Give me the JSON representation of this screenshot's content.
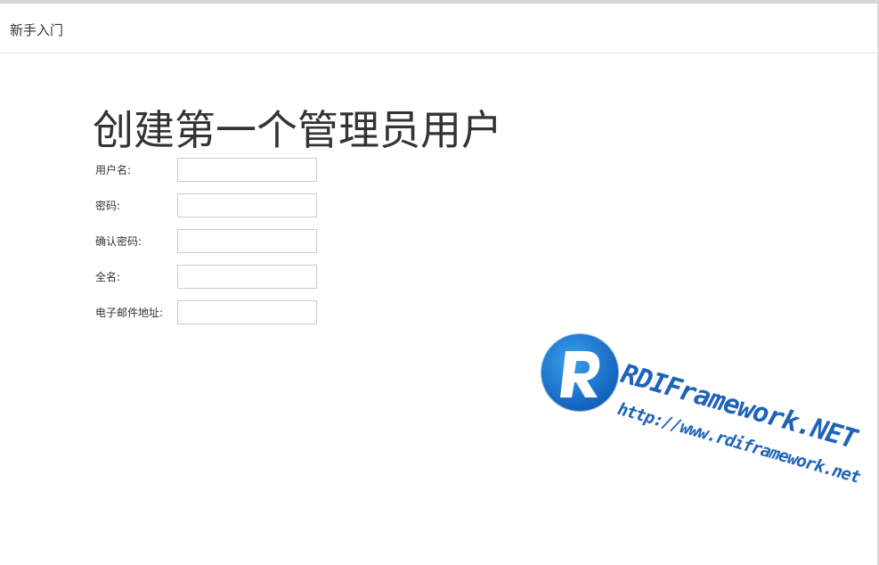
{
  "header": {
    "title": "新手入门"
  },
  "page": {
    "title": "创建第一个管理员用户"
  },
  "form": {
    "fields": [
      {
        "label": "用户名:",
        "value": ""
      },
      {
        "label": "密码:",
        "value": ""
      },
      {
        "label": "确认密码:",
        "value": ""
      },
      {
        "label": "全名:",
        "value": ""
      },
      {
        "label": "电子邮件地址:",
        "value": ""
      }
    ]
  },
  "watermark": {
    "logo_letter": "R",
    "brand": "RDIFramework.NET",
    "url": "http://www.rdiframework.net",
    "color": "#1e63b8"
  }
}
